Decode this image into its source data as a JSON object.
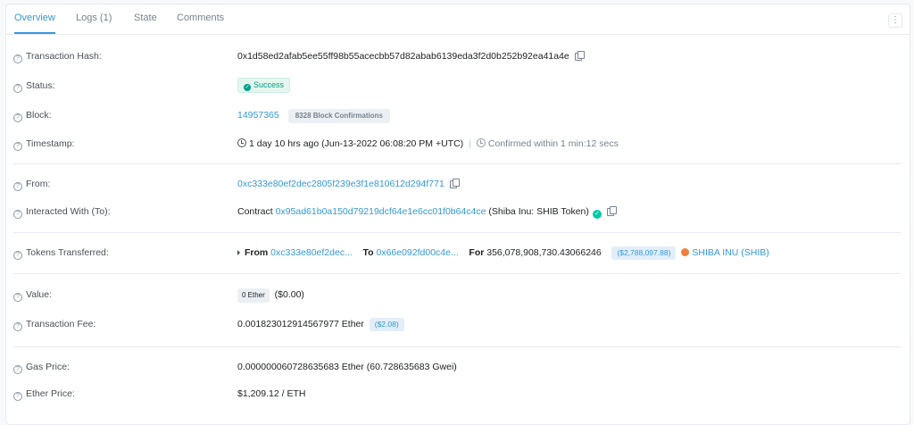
{
  "tabs": [
    {
      "label": "Overview"
    },
    {
      "label": "Logs (1)"
    },
    {
      "label": "State"
    },
    {
      "label": "Comments"
    }
  ],
  "menu_label": "⋮",
  "fields": {
    "tx_hash": {
      "label": "Transaction Hash:",
      "value": "0x1d58ed2afab5ee55ff98b55acecbb57d82abab6139eda3f2d0b252b92ea41a4e"
    },
    "status": {
      "label": "Status:",
      "value": "Success"
    },
    "block": {
      "label": "Block:",
      "value": "14957365",
      "confirmations": "8328 Block Confirmations"
    },
    "timestamp": {
      "label": "Timestamp:",
      "value": "1 day 10 hrs ago (Jun-13-2022 06:08:20 PM +UTC)",
      "confirmed": "Confirmed within 1 min:12 secs"
    },
    "from": {
      "label": "From:",
      "value": "0xc333e80ef2dec2805f239e3f1e810612d294f771"
    },
    "interacted": {
      "label": "Interacted With (To):",
      "prefix": "Contract",
      "address": "0x95ad61b0a150d79219dcf64e1e6cc01f0b64c4ce",
      "name": "(Shiba Inu: SHIB Token)"
    },
    "tokens": {
      "label": "Tokens Transferred:",
      "from_label": "From",
      "from_addr": "0xc333e80ef2dec...",
      "to_label": "To",
      "to_addr": "0x66e092fd00c4e...",
      "for_label": "For",
      "amount": "356,078,908,730.43066246",
      "usd": "($2,788,097.88)",
      "token": "SHIBA INU (SHIB)"
    },
    "value": {
      "label": "Value:",
      "ether": "0 Ether",
      "usd": "($0.00)"
    },
    "fee": {
      "label": "Transaction Fee:",
      "value": "0.001823012914567977 Ether",
      "usd": "($2.08)"
    },
    "gas_price": {
      "label": "Gas Price:",
      "value": "0.000000060728635683 Ether (60.728635683 Gwei)"
    },
    "ether_price": {
      "label": "Ether Price:",
      "value": "$1,209.12 / ETH"
    }
  },
  "colors": {
    "link": "#3498db",
    "success": "#00a186",
    "border": "#e7eaf3"
  }
}
